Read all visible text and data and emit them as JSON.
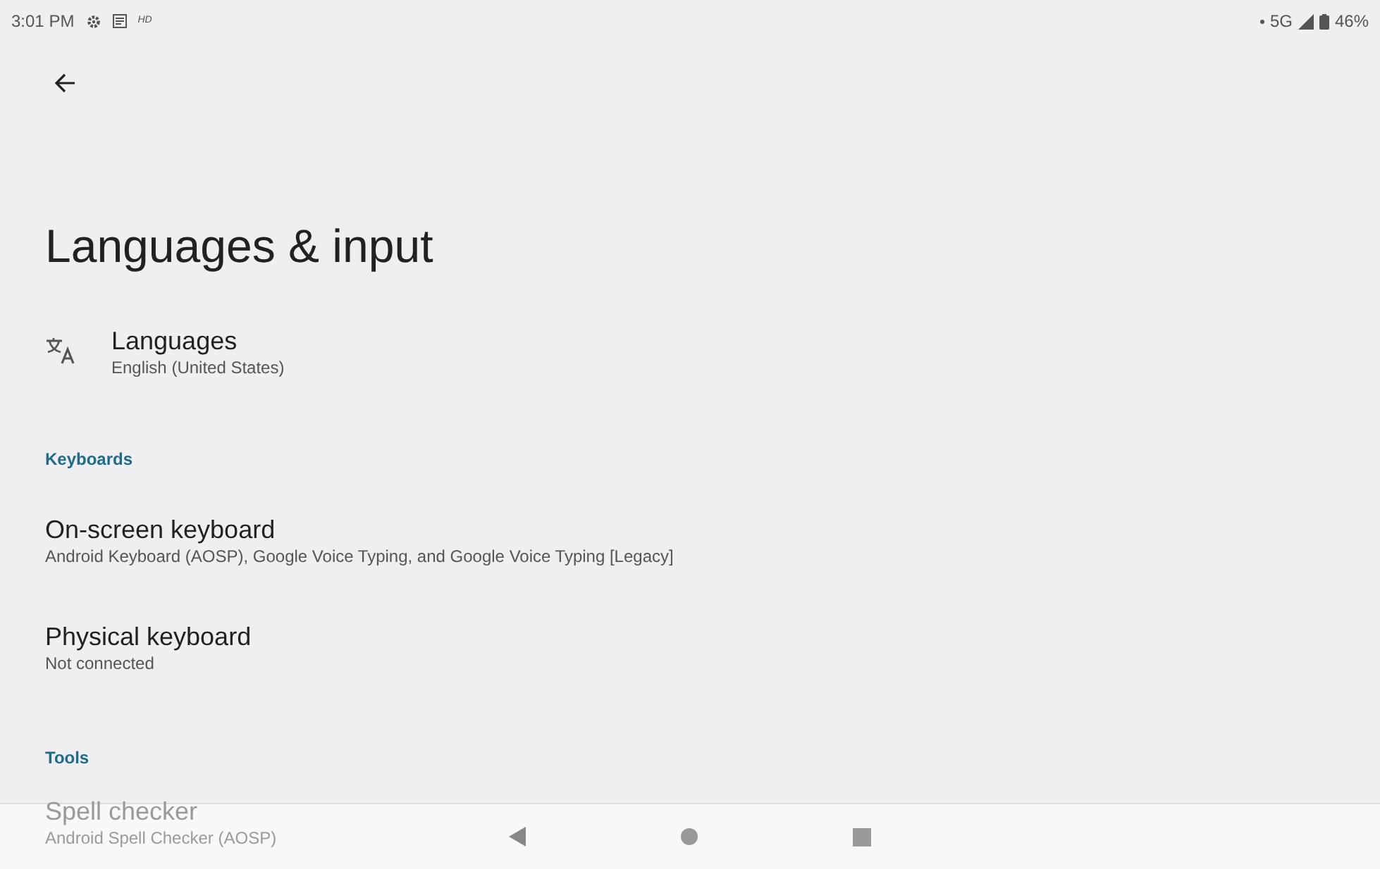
{
  "status_bar": {
    "time": "3:01 PM",
    "hd_label": "HD",
    "network": "5G",
    "battery": "46%"
  },
  "title": "Languages & input",
  "items": [
    {
      "kind": "icon_item",
      "title": "Languages",
      "subtitle": "English (United States)"
    },
    {
      "kind": "header",
      "title": "Keyboards"
    },
    {
      "kind": "item",
      "title": "On-screen keyboard",
      "subtitle": "Android Keyboard (AOSP), Google Voice Typing, and Google Voice Typing [Legacy]"
    },
    {
      "kind": "item",
      "title": "Physical keyboard",
      "subtitle": "Not connected"
    },
    {
      "kind": "header",
      "title": "Tools"
    },
    {
      "kind": "item",
      "title": "Spell checker",
      "subtitle": "Android Spell Checker (AOSP)"
    }
  ]
}
